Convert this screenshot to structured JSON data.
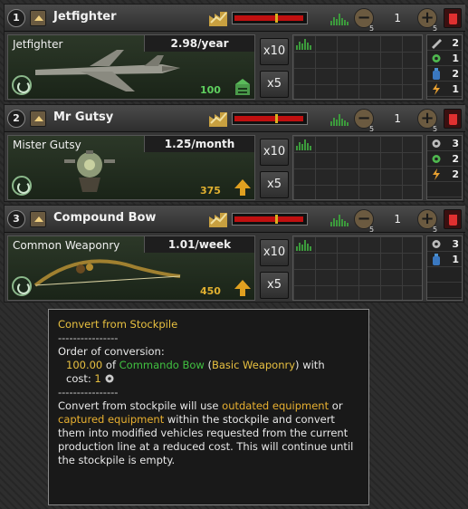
{
  "lines": [
    {
      "number": "1",
      "title": "Jetfighter",
      "equipment_name": "Jetfighter",
      "rate": "2.98/year",
      "value": "100",
      "value_color": "green",
      "value_icon": "factory-icon",
      "efficiency": 0.97,
      "factory_count": "1",
      "mult_10": "x10",
      "mult_5": "x5",
      "step": "5",
      "resources": [
        {
          "icon": "wrench-icon",
          "value": "2"
        },
        {
          "icon": "gear-icon",
          "value": "1"
        },
        {
          "icon": "bottle-icon",
          "value": "2"
        },
        {
          "icon": "lightning-icon",
          "value": "1"
        }
      ]
    },
    {
      "number": "2",
      "title": "Mr Gutsy",
      "equipment_name": "Mister Gutsy",
      "rate": "1.25/month",
      "value": "375",
      "value_color": "gold",
      "value_icon": "arrow-up-icon",
      "efficiency": 0.97,
      "factory_count": "1",
      "mult_10": "x10",
      "mult_5": "x5",
      "step": "5",
      "resources": [
        {
          "icon": "cog-icon",
          "value": "3"
        },
        {
          "icon": "gear-icon",
          "value": "2"
        },
        {
          "icon": "lightning-icon",
          "value": "2"
        }
      ]
    },
    {
      "number": "3",
      "title": "Compound Bow",
      "equipment_name": "Common Weaponry",
      "rate": "1.01/week",
      "value": "450",
      "value_color": "gold",
      "value_icon": "arrow-up-icon",
      "efficiency": 0.97,
      "factory_count": "1",
      "mult_10": "x10",
      "mult_5": "x5",
      "step": "5",
      "resources": [
        {
          "icon": "cog-icon",
          "value": "3"
        },
        {
          "icon": "bottle-icon",
          "value": "1"
        }
      ]
    }
  ],
  "tooltip": {
    "title": "Convert from Stockpile",
    "dashes": "----------------",
    "order_label": "Order of conversion:",
    "amount": "100.00",
    "of": "of",
    "item": "Commando Bow",
    "category": "Basic Weaponry",
    "with": "with",
    "cost_label": "cost:",
    "cost_value": "1",
    "desc_1": "Convert from stockpile will use",
    "outdated": "outdated equipment",
    "or": "or",
    "captured": "captured equipment",
    "desc_2": "within the stockpile and convert them into modified vehicles requested from the current production line at a reduced cost. This will continue until the stockpile is empty."
  },
  "colors": {
    "green_text": "#40c040",
    "gold_text": "#e8c040",
    "efficiency_red": "#c01010"
  }
}
